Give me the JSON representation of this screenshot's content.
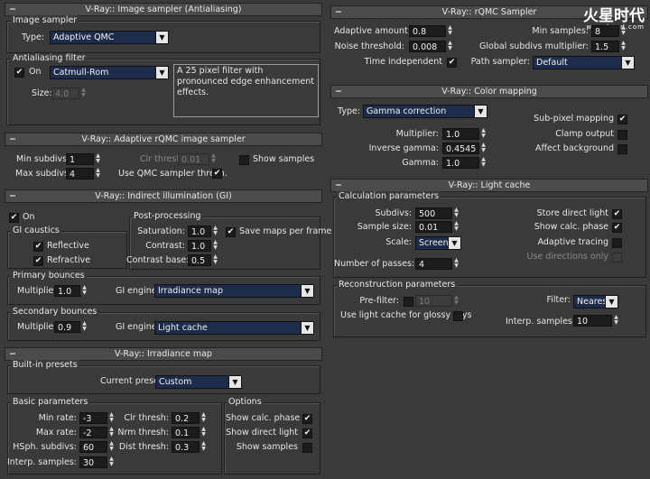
{
  "rollouts": {
    "image_sampler": {
      "title": "V-Ray:: Image sampler (Antialiasing)",
      "group_image_sampler": "Image sampler",
      "type_label": "Type:",
      "type_value": "Adaptive QMC",
      "group_aa_filter": "Antialiasing filter",
      "on_label": "On",
      "on_checked": true,
      "filter_value": "Catmull-Rom",
      "filter_desc": "A 25 pixel filter with pronounced edge enhancement effects.",
      "size_label": "Size:",
      "size_value": "4.0"
    },
    "adaptive_rqmc": {
      "title": "V-Ray:: Adaptive rQMC image sampler",
      "min_subdivs_label": "Min subdivs:",
      "min_subdivs": "1",
      "max_subdivs_label": "Max subdivs:",
      "max_subdivs": "4",
      "clr_thresh_label": "Clr thresh:",
      "clr_thresh": "0.01",
      "use_qmc_label": "Use QMC sampler thresh.",
      "use_qmc_checked": true,
      "show_samples_label": "Show samples",
      "show_samples_checked": false
    },
    "gi": {
      "title": "V-Ray:: Indirect illumination (GI)",
      "on_label": "On",
      "on_checked": true,
      "group_caustics": "GI caustics",
      "reflective_label": "Reflective",
      "reflective_checked": true,
      "refractive_label": "Refractive",
      "refractive_checked": true,
      "group_post": "Post-processing",
      "saturation_label": "Saturation:",
      "saturation": "1.0",
      "contrast_label": "Contrast:",
      "contrast": "1.0",
      "contrast_base_label": "Contrast base:",
      "contrast_base": "0.5",
      "save_maps_label": "Save maps per frame",
      "save_maps_checked": true,
      "group_primary": "Primary bounces",
      "primary_multiplier_label": "Multiplier:",
      "primary_multiplier": "1.0",
      "primary_engine_label": "GI engine:",
      "primary_engine": "Irradiance map",
      "group_secondary": "Secondary bounces",
      "secondary_multiplier_label": "Multiplier:",
      "secondary_multiplier": "0.9",
      "secondary_engine_label": "GI engine:",
      "secondary_engine": "Light cache"
    },
    "irradiance": {
      "title": "V-Ray:: Irradiance map",
      "group_presets": "Built-in presets",
      "current_preset_label": "Current preset:",
      "current_preset": "Custom",
      "group_basic": "Basic parameters",
      "min_rate_label": "Min rate:",
      "min_rate": "-3",
      "max_rate_label": "Max rate:",
      "max_rate": "-2",
      "hsph_label": "HSph. subdivs:",
      "hsph": "60",
      "interp_label": "Interp. samples:",
      "interp": "30",
      "clr_thresh_label": "Clr thresh:",
      "clr_thresh": "0.2",
      "nrm_thresh_label": "Nrm thresh:",
      "nrm_thresh": "0.1",
      "dist_thresh_label": "Dist thresh:",
      "dist_thresh": "0.3",
      "group_options": "Options",
      "show_calc_label": "Show calc. phase",
      "show_calc_checked": true,
      "show_direct_label": "Show direct light",
      "show_direct_checked": true,
      "show_samples_label": "Show samples",
      "show_samples_checked": false
    },
    "rqmc": {
      "title": "V-Ray:: rQMC Sampler",
      "adaptive_amount_label": "Adaptive amount:",
      "adaptive_amount": "0.8",
      "min_samples_label": "Min samples:",
      "min_samples": "8",
      "noise_threshold_label": "Noise threshold:",
      "noise_threshold": "0.008",
      "global_subdivs_label": "Global subdivs multiplier:",
      "global_subdivs": "1.5",
      "time_independent_label": "Time independent",
      "time_independent_checked": true,
      "path_sampler_label": "Path sampler:",
      "path_sampler": "Default"
    },
    "color_mapping": {
      "title": "V-Ray:: Color mapping",
      "type_label": "Type:",
      "type_value": "Gamma correction",
      "multiplier_label": "Multiplier:",
      "multiplier": "1.0",
      "inverse_gamma_label": "Inverse gamma:",
      "inverse_gamma": "0.4545",
      "gamma_label": "Gamma:",
      "gamma": "1.0",
      "sub_pixel_label": "Sub-pixel mapping",
      "sub_pixel_checked": true,
      "clamp_label": "Clamp output",
      "clamp_checked": false,
      "affect_bg_label": "Affect background",
      "affect_bg_checked": false
    },
    "light_cache": {
      "title": "V-Ray:: Light cache",
      "group_calc": "Calculation parameters",
      "subdivs_label": "Subdivs:",
      "subdivs": "500",
      "sample_size_label": "Sample size:",
      "sample_size": "0.01",
      "scale_label": "Scale:",
      "scale": "Screen",
      "passes_label": "Number of passes:",
      "passes": "4",
      "store_direct_label": "Store direct light",
      "store_direct_checked": true,
      "show_calc_label": "Show calc. phase",
      "show_calc_checked": true,
      "adaptive_tracing_label": "Adaptive tracing",
      "adaptive_tracing_checked": false,
      "use_directions_label": "Use directions only",
      "use_directions_checked": false,
      "group_recon": "Reconstruction parameters",
      "prefilter_label": "Pre-filter:",
      "prefilter_checked": false,
      "prefilter": "10",
      "glossy_label": "Use light cache for glossy rays",
      "glossy_checked": false,
      "filter_label": "Filter:",
      "filter": "Nearest",
      "interp_label": "Interp. samples:",
      "interp": "10"
    }
  },
  "watermark": {
    "name": "火星时代",
    "url": "www.hxsd.com"
  },
  "icons": {
    "expand": "minus-icon",
    "arrow": "spinner-arrows-icon",
    "check": "check-mark",
    "dropdown": "chevron-down-icon"
  },
  "colors": {
    "panel": "#3a3a3a",
    "field": "#1c1c1c",
    "dropdown": "#1e2c4c",
    "header": "#4b4b4b"
  }
}
